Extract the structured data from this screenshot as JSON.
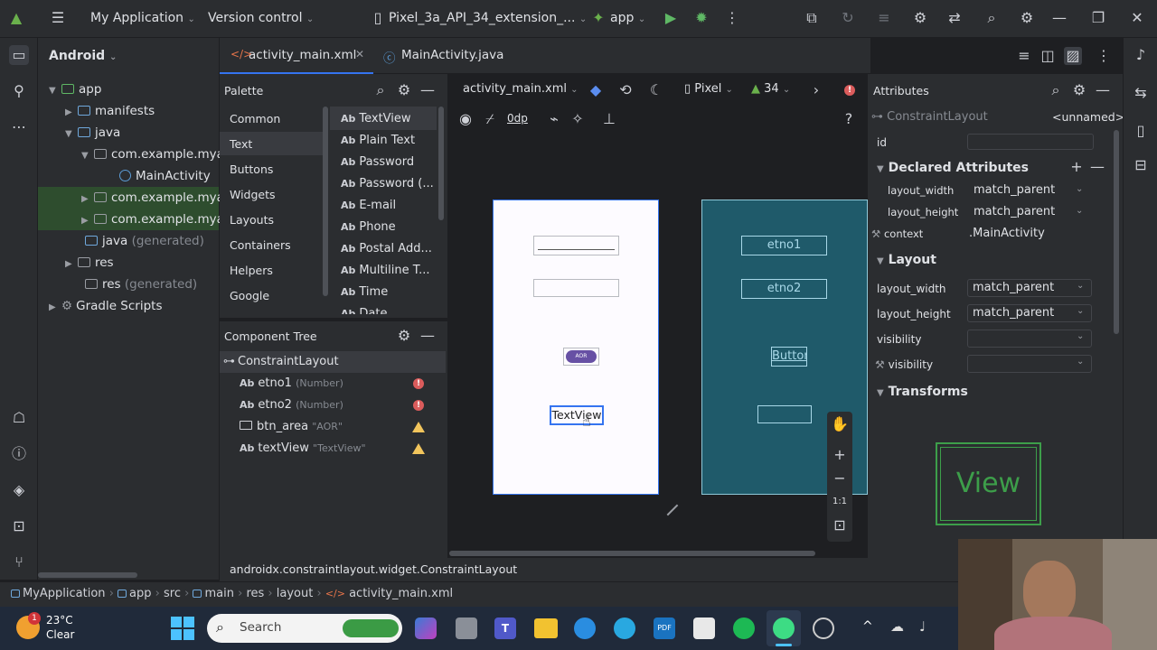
{
  "titlebar": {
    "project": "My Application",
    "vcs": "Version control",
    "device": "Pixel_3a_API_34_extension_...",
    "run_config": "app"
  },
  "project_panel": {
    "title": "Android",
    "tree": [
      {
        "label": "app",
        "kind": "module"
      },
      {
        "label": "manifests",
        "kind": "folder"
      },
      {
        "label": "java",
        "kind": "folder"
      },
      {
        "label": "com.example.mya",
        "kind": "package"
      },
      {
        "label": "MainActivity",
        "kind": "class"
      },
      {
        "label": "com.example.mya",
        "kind": "package"
      },
      {
        "label": "com.example.mya",
        "kind": "package"
      },
      {
        "label": "java",
        "suffix": "(generated)",
        "kind": "folder"
      },
      {
        "label": "res",
        "kind": "folder"
      },
      {
        "label": "res",
        "suffix": "(generated)",
        "kind": "folder"
      },
      {
        "label": "Gradle Scripts",
        "kind": "gradle"
      }
    ]
  },
  "tabs": [
    {
      "label": "activity_main.xml",
      "active": true
    },
    {
      "label": "MainActivity.java",
      "active": false
    }
  ],
  "palette": {
    "title": "Palette",
    "categories": [
      "Common",
      "Text",
      "Buttons",
      "Widgets",
      "Layouts",
      "Containers",
      "Helpers",
      "Google"
    ],
    "items": [
      "TextView",
      "Plain Text",
      "Password",
      "Password (...",
      "E-mail",
      "Phone",
      "Postal Add...",
      "Multiline T...",
      "Time",
      "Date"
    ]
  },
  "component_tree": {
    "title": "Component Tree",
    "root": "ConstraintLayout",
    "items": [
      {
        "icon": "Ab",
        "name": "etno1",
        "sub": "(Number)",
        "status": "error"
      },
      {
        "icon": "Ab",
        "name": "etno2",
        "sub": "(Number)",
        "status": "error"
      },
      {
        "icon": "btn",
        "name": "btn_area",
        "sub": "\"AOR\"",
        "status": "warning"
      },
      {
        "icon": "Ab",
        "name": "textView",
        "sub": "\"TextView\"",
        "status": "warning"
      }
    ]
  },
  "design_toolbar": {
    "file": "activity_main.xml",
    "device": "Pixel",
    "api": "34",
    "margin": "0dp"
  },
  "design_preview": {
    "button_label": "AOR",
    "textview_label": "TextView"
  },
  "blueprint": {
    "etno1": "etno1",
    "etno2": "etno2",
    "button": "Button"
  },
  "zoom_controls": {
    "ratio": "1:1"
  },
  "attributes": {
    "title": "Attributes",
    "component": "ConstraintLayout",
    "id_value": "<unnamed>",
    "id_label": "id",
    "declared_title": "Declared Attributes",
    "declared": [
      {
        "name": "layout_width",
        "value": "match_parent"
      },
      {
        "name": "layout_height",
        "value": "match_parent"
      },
      {
        "name": "context",
        "value": ".MainActivity"
      }
    ],
    "layout_title": "Layout",
    "layout": [
      {
        "name": "layout_width",
        "value": "match_parent"
      },
      {
        "name": "layout_height",
        "value": "match_parent"
      },
      {
        "name": "visibility",
        "value": ""
      },
      {
        "name": "visibility",
        "value": ""
      }
    ],
    "transforms_title": "Transforms",
    "view_preview": "View"
  },
  "statusbar": {
    "text": "androidx.constraintlayout.widget.ConstraintLayout"
  },
  "breadcrumbs": [
    "MyApplication",
    "app",
    "src",
    "main",
    "res",
    "layout",
    "activity_main.xml"
  ],
  "taskbar": {
    "temperature": "23°C",
    "weather": "Clear",
    "weather_badge": "1",
    "search": "Search"
  }
}
